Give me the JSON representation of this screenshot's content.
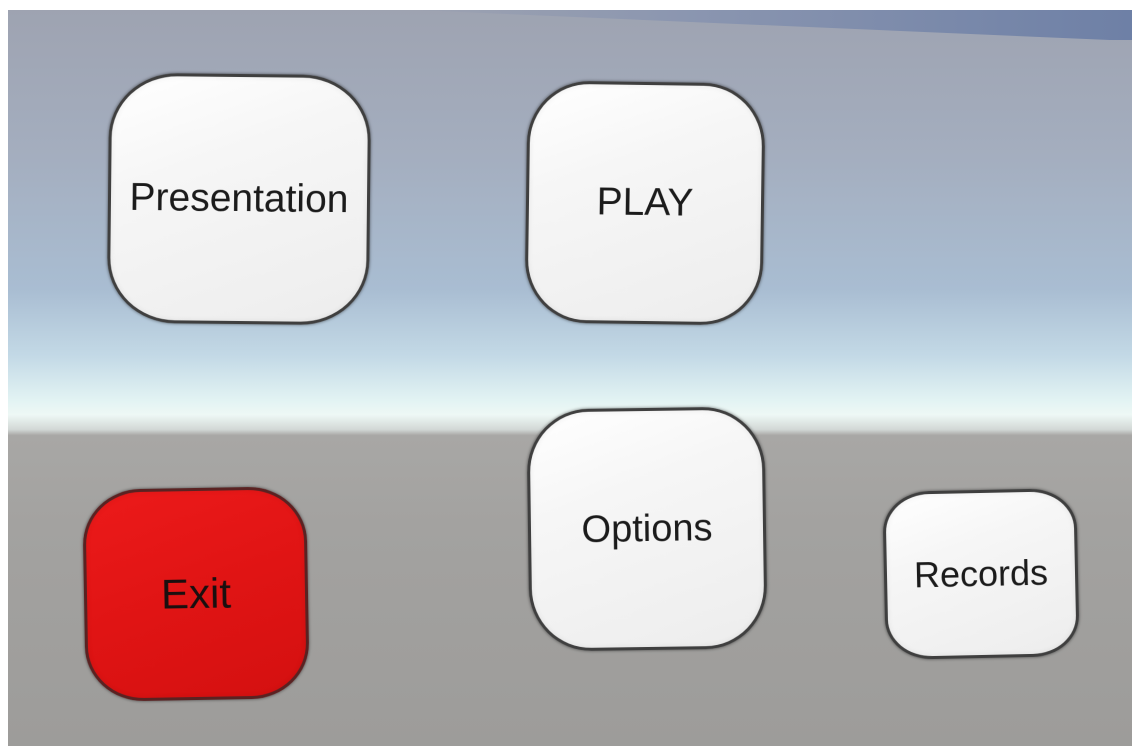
{
  "menu": {
    "buttons": {
      "presentation": {
        "label": "Presentation"
      },
      "play": {
        "label": "PLAY"
      },
      "options": {
        "label": "Options"
      },
      "records": {
        "label": "Records"
      },
      "exit": {
        "label": "Exit"
      }
    }
  },
  "colors": {
    "button_face": "#f2f2f2",
    "button_border": "#3f3f3f",
    "exit_button": "#e01414",
    "sky_top": "#9ea3b1",
    "horizon": "#eef8f5",
    "ground": "#a3a2a0"
  }
}
